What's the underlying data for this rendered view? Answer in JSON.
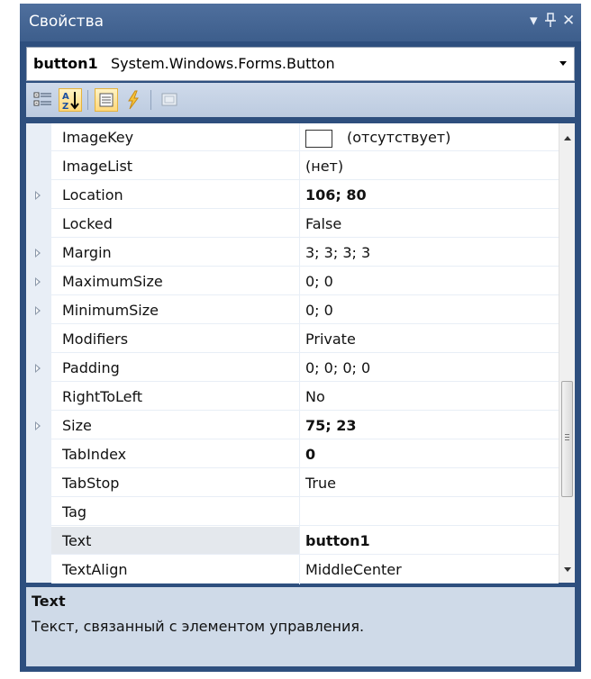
{
  "window": {
    "title": "Свойства",
    "title_buttons": [
      "dropdown-arrow",
      "pin",
      "close"
    ]
  },
  "object_selector": {
    "name": "button1",
    "type": "System.Windows.Forms.Button"
  },
  "toolbar": {
    "buttons": [
      {
        "icon": "categorized-icon",
        "active": false
      },
      {
        "icon": "alphabetical-sort-icon",
        "active": true
      },
      {
        "icon": "properties-icon",
        "active": true
      },
      {
        "icon": "events-lightning-icon",
        "active": false
      },
      {
        "icon": "property-pages-icon",
        "active": false
      }
    ]
  },
  "properties": [
    {
      "name": "ImageKey",
      "value": "(отсутствует)",
      "expandable": false,
      "bold": false,
      "swatch": true
    },
    {
      "name": "ImageList",
      "value": "(нет)",
      "expandable": false,
      "bold": false
    },
    {
      "name": "Location",
      "value": "106; 80",
      "expandable": true,
      "bold": true
    },
    {
      "name": "Locked",
      "value": "False",
      "expandable": false,
      "bold": false
    },
    {
      "name": "Margin",
      "value": "3; 3; 3; 3",
      "expandable": true,
      "bold": false
    },
    {
      "name": "MaximumSize",
      "value": "0; 0",
      "expandable": true,
      "bold": false
    },
    {
      "name": "MinimumSize",
      "value": "0; 0",
      "expandable": true,
      "bold": false
    },
    {
      "name": "Modifiers",
      "value": "Private",
      "expandable": false,
      "bold": false
    },
    {
      "name": "Padding",
      "value": "0; 0; 0; 0",
      "expandable": true,
      "bold": false
    },
    {
      "name": "RightToLeft",
      "value": "No",
      "expandable": false,
      "bold": false
    },
    {
      "name": "Size",
      "value": "75; 23",
      "expandable": true,
      "bold": true
    },
    {
      "name": "TabIndex",
      "value": "0",
      "expandable": false,
      "bold": true
    },
    {
      "name": "TabStop",
      "value": "True",
      "expandable": false,
      "bold": false
    },
    {
      "name": "Tag",
      "value": "",
      "expandable": false,
      "bold": false
    },
    {
      "name": "Text",
      "value": "button1",
      "expandable": false,
      "bold": true,
      "selected": true
    },
    {
      "name": "TextAlign",
      "value": "MiddleCenter",
      "expandable": false,
      "bold": false
    }
  ],
  "description": {
    "title": "Text",
    "text": "Текст, связанный с элементом управления."
  },
  "colors": {
    "frame": "#2e4f7e",
    "titlebar": "#4f6f9d",
    "toolbar": "#c5d3e6",
    "gutter": "#e8eef6",
    "description_bg": "#cfdae8",
    "active_button": "#ffd87a"
  }
}
